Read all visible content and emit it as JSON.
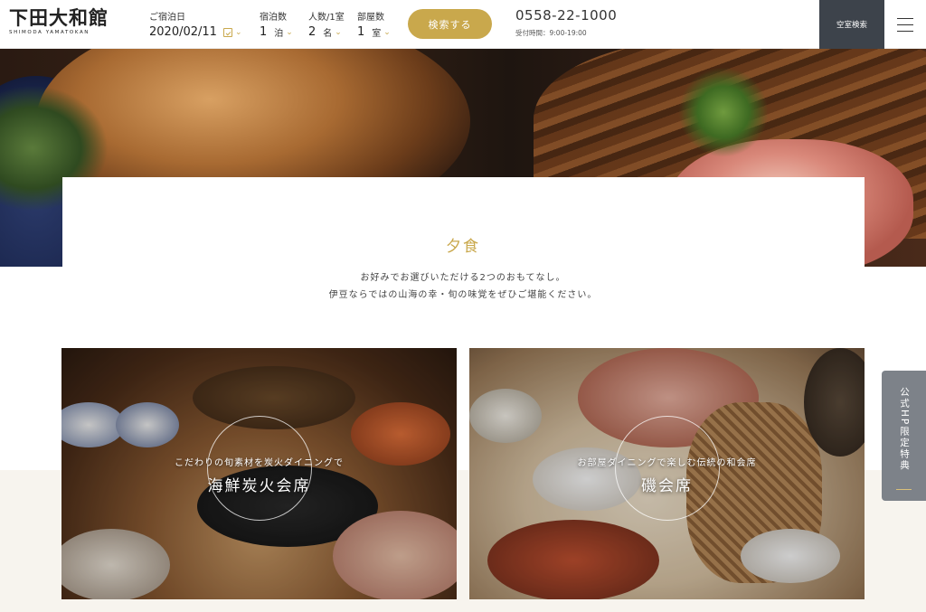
{
  "header": {
    "logo_main": "下田大和館",
    "logo_sub": "SHIMODA YAMATOKAN",
    "checkin_label": "ご宿泊日",
    "checkin_value": "2020/02/11",
    "nights_label": "宿泊数",
    "nights_value": "1",
    "nights_unit": "泊",
    "guests_label": "人数/1室",
    "guests_value": "2",
    "guests_unit": "名",
    "rooms_label": "部屋数",
    "rooms_value": "1",
    "rooms_unit": "室",
    "search_label": "検索する",
    "phone": "0558-22-1000",
    "hours": "受付時間：9:00-19:00",
    "vacancy_label": "空室検索"
  },
  "main": {
    "section_title": "夕食",
    "intro_line1": "お好みでお選びいただける2つのおもてなし。",
    "intro_line2": "伊豆ならではの山海の幸・旬の味覚をぜひご堪能ください。"
  },
  "tiles": [
    {
      "sub": "こだわりの旬素材を炭火ダイニングで",
      "name": "海鮮炭火会席"
    },
    {
      "sub": "お部屋ダイニングで楽しむ伝統の和会席",
      "name": "磯会席"
    }
  ],
  "side_tab": {
    "label": "公式HP限定特典"
  },
  "colors": {
    "accent": "#c9a84c",
    "vacancy_bg": "#3d434b",
    "side_tab_bg": "#7d8289"
  },
  "icons": [
    "calendar-icon",
    "chevron-down-icon",
    "hamburger-menu-icon"
  ]
}
